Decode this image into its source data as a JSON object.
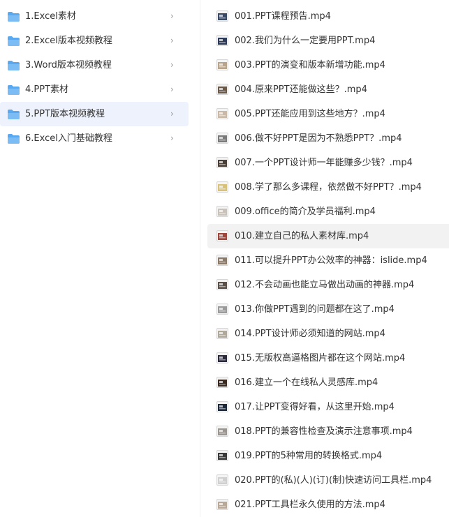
{
  "folders": {
    "items": [
      {
        "label": "1.Excel素材",
        "chevron": "›",
        "selected": false
      },
      {
        "label": "2.Excel版本视频教程",
        "chevron": "›",
        "selected": false
      },
      {
        "label": "3.Word版本视频教程",
        "chevron": "›",
        "selected": false
      },
      {
        "label": "4.PPT素材",
        "chevron": "›",
        "selected": false
      },
      {
        "label": "5.PPT版本视频教程",
        "chevron": "›",
        "selected": true
      },
      {
        "label": "6.Excel入门基础教程",
        "chevron": "›",
        "selected": false
      }
    ],
    "icon": "folder-icon",
    "icon_color": "#5aa9f0"
  },
  "files": {
    "hovered_index": 9,
    "items": [
      {
        "label": "001.PPT课程预告.mp4",
        "thumb": "video-thumbnail-icon",
        "thumb_color": "#3a4a66"
      },
      {
        "label": "002.我们为什么一定要用PPT.mp4",
        "thumb": "video-thumbnail-icon",
        "thumb_color": "#2d3a5a"
      },
      {
        "label": "003.PPT的演变和版本新增功能.mp4",
        "thumb": "video-thumbnail-icon",
        "thumb_color": "#b8a48a"
      },
      {
        "label": "004.原来PPT还能做这些？.mp4",
        "thumb": "video-thumbnail-icon",
        "thumb_color": "#6b5a4a"
      },
      {
        "label": "005.PPT还能应用到这些地方？.mp4",
        "thumb": "video-thumbnail-icon",
        "thumb_color": "#c9b9a6"
      },
      {
        "label": "006.做不好PPT是因为不熟悉PPT？.mp4",
        "thumb": "video-thumbnail-icon",
        "thumb_color": "#7a7a7a"
      },
      {
        "label": "007.一个PPT设计师一年能赚多少钱？.mp4",
        "thumb": "video-thumbnail-icon",
        "thumb_color": "#4a4038"
      },
      {
        "label": "008.学了那么多课程，依然做不好PPT？.mp4",
        "thumb": "video-thumbnail-icon",
        "thumb_color": "#d8c27a"
      },
      {
        "label": "009.office的简介及学员福利.mp4",
        "thumb": "video-thumbnail-icon",
        "thumb_color": "#c8c2bb"
      },
      {
        "label": "010.建立自己的私人素材库.mp4",
        "thumb": "video-thumbnail-icon",
        "thumb_color": "#a0453a"
      },
      {
        "label": "011.可以提升PPT办公效率的神器：islide.mp4",
        "thumb": "video-thumbnail-icon",
        "thumb_color": "#8a7a6a"
      },
      {
        "label": "012.不会动画也能立马做出动画的神器.mp4",
        "thumb": "video-thumbnail-icon",
        "thumb_color": "#5a5048"
      },
      {
        "label": "013.你做PPT遇到的问题都在这了.mp4",
        "thumb": "video-thumbnail-icon",
        "thumb_color": "#9a9a9a"
      },
      {
        "label": "014.PPT设计师必须知道的网站.mp4",
        "thumb": "video-thumbnail-icon",
        "thumb_color": "#b0a898"
      },
      {
        "label": "015.无版权高逼格图片都在这个网站.mp4",
        "thumb": "video-thumbnail-icon",
        "thumb_color": "#2a2a3a"
      },
      {
        "label": "016.建立一个在线私人灵感库.mp4",
        "thumb": "video-thumbnail-icon",
        "thumb_color": "#3a2a20"
      },
      {
        "label": "017.让PPT变得好看，从这里开始.mp4",
        "thumb": "video-thumbnail-icon",
        "thumb_color": "#1e2a3a"
      },
      {
        "label": "018.PPT的兼容性检查及演示注意事项.mp4",
        "thumb": "video-thumbnail-icon",
        "thumb_color": "#9a958e"
      },
      {
        "label": "019.PPT的5种常用的转换格式.mp4",
        "thumb": "video-thumbnail-icon",
        "thumb_color": "#3a3a3a"
      },
      {
        "label": "020.PPT的(私)(人)(订)(制)快速访问工具栏.mp4",
        "thumb": "video-thumbnail-icon",
        "thumb_color": "#d0d0d0"
      },
      {
        "label": "021.PPT工具栏永久使用的方法.mp4",
        "thumb": "video-thumbnail-icon",
        "thumb_color": "#b8a898"
      }
    ]
  }
}
